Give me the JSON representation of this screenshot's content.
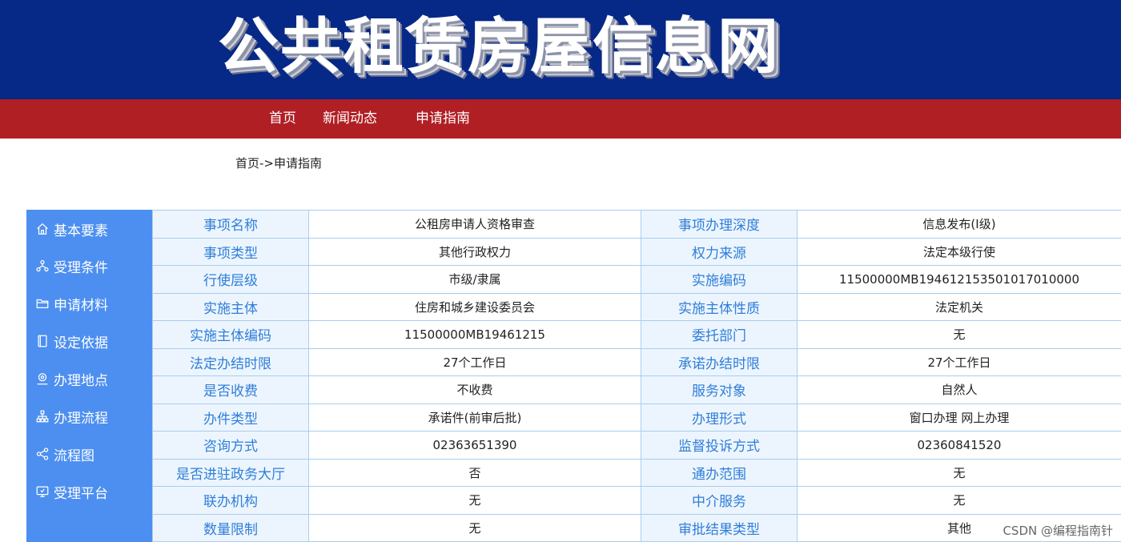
{
  "header": {
    "site_title": "公共租赁房屋信息网"
  },
  "nav": {
    "items": [
      "首页",
      "新闻动态",
      "申请指南"
    ]
  },
  "breadcrumb": {
    "home": "首页",
    "separator": "->",
    "current": "申请指南"
  },
  "sidebar": {
    "items": [
      {
        "label": "基本要素",
        "icon": "home-icon"
      },
      {
        "label": "受理条件",
        "icon": "hierarchy-icon"
      },
      {
        "label": "申请材料",
        "icon": "folder-icon"
      },
      {
        "label": "设定依据",
        "icon": "document-icon"
      },
      {
        "label": "办理地点",
        "icon": "location-pin-icon"
      },
      {
        "label": "办理流程",
        "icon": "flow-icon"
      },
      {
        "label": "流程图",
        "icon": "share-icon"
      },
      {
        "label": "受理平台",
        "icon": "monitor-icon"
      }
    ]
  },
  "table": {
    "rows": [
      [
        "事项名称",
        "公租房申请人资格审查",
        "事项办理深度",
        "信息发布(Ⅰ级)"
      ],
      [
        "事项类型",
        "其他行政权力",
        "权力来源",
        "法定本级行使"
      ],
      [
        "行使层级",
        "市级/隶属",
        "实施编码",
        "11500000MB19461215350101701000​0"
      ],
      [
        "实施主体",
        "住房和城乡建设委员会",
        "实施主体性质",
        "法定机关"
      ],
      [
        "实施主体编码",
        "11500000MB19461215",
        "委托部门",
        "无"
      ],
      [
        "法定办结时限",
        "27个工作日",
        "承诺办结时限",
        "27个工作日"
      ],
      [
        "是否收费",
        "不收费",
        "服务对象",
        "自然人"
      ],
      [
        "办件类型",
        "承诺件(前审后批)",
        "办理形式",
        "窗口办理  网上办理"
      ],
      [
        "咨询方式",
        "02363651390",
        "监督投诉方式",
        "02360841520"
      ],
      [
        "是否进驻政务大厅",
        "否",
        "通办范围",
        "无"
      ],
      [
        "联办机构",
        "无",
        "中介服务",
        "无"
      ],
      [
        "数量限制",
        "无",
        "审批结果类型",
        "其他"
      ]
    ]
  },
  "watermark": "CSDN @编程指南针",
  "colors": {
    "banner": "#062887",
    "nav": "#b01f24",
    "sidebar": "#4d8ff0",
    "label_text": "#2f7ed8",
    "label_bg": "#ecf5fe",
    "border": "#a9cdef"
  }
}
